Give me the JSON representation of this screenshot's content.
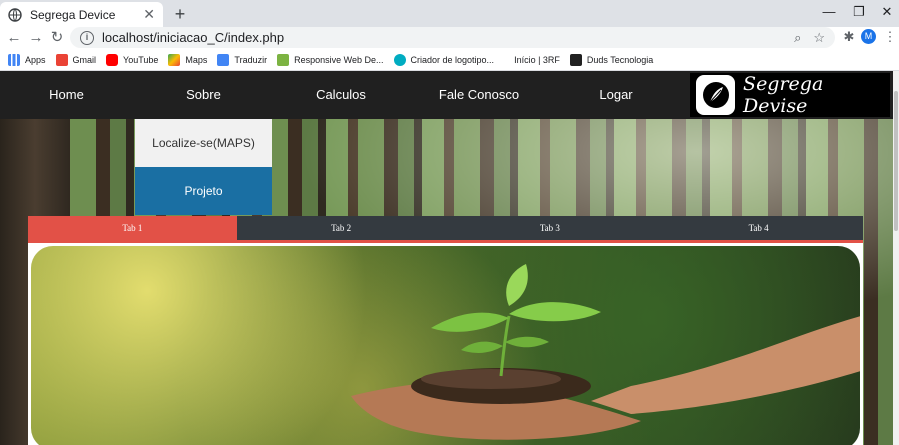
{
  "browser": {
    "tab_title": "Segrega Device",
    "new_tab_symbol": "+",
    "url": "localhost/iniciacao_C/index.php",
    "avatar_letter": "M",
    "window_controls": [
      "—",
      "❐",
      "✕"
    ]
  },
  "bookmarks": [
    {
      "label": "Apps",
      "icon": "apps-grid-icon",
      "color": "#4285f4"
    },
    {
      "label": "Gmail",
      "icon": "gmail-icon",
      "color": "#ea4335"
    },
    {
      "label": "YouTube",
      "icon": "youtube-icon",
      "color": "#ff0000"
    },
    {
      "label": "Maps",
      "icon": "maps-icon",
      "color": "#34a853"
    },
    {
      "label": "Traduzir",
      "icon": "translate-icon",
      "color": "#4285f4"
    },
    {
      "label": "Responsive Web De...",
      "icon": "web-icon",
      "color": "#7cb342"
    },
    {
      "label": "Criador de logotipo...",
      "icon": "logo-maker-icon",
      "color": "#00acc1"
    },
    {
      "label": "Início | 3RF",
      "icon": "blank-icon",
      "color": "#ffffff"
    },
    {
      "label": "Duds Tecnologia",
      "icon": "duds-icon",
      "color": "#212121"
    }
  ],
  "navbar": {
    "items": [
      "Home",
      "Sobre",
      "Calculos",
      "Fale Conosco",
      "Logar"
    ],
    "brand": "Segrega Devise"
  },
  "dropdown": {
    "items": [
      "Localize-se(MAPS)",
      "Projeto"
    ]
  },
  "tabs": {
    "items": [
      "Tab 1",
      "Tab 2",
      "Tab 3",
      "Tab 4"
    ],
    "active_index": 0,
    "active_color": "#e25147",
    "inactive_color": "#343a40"
  }
}
